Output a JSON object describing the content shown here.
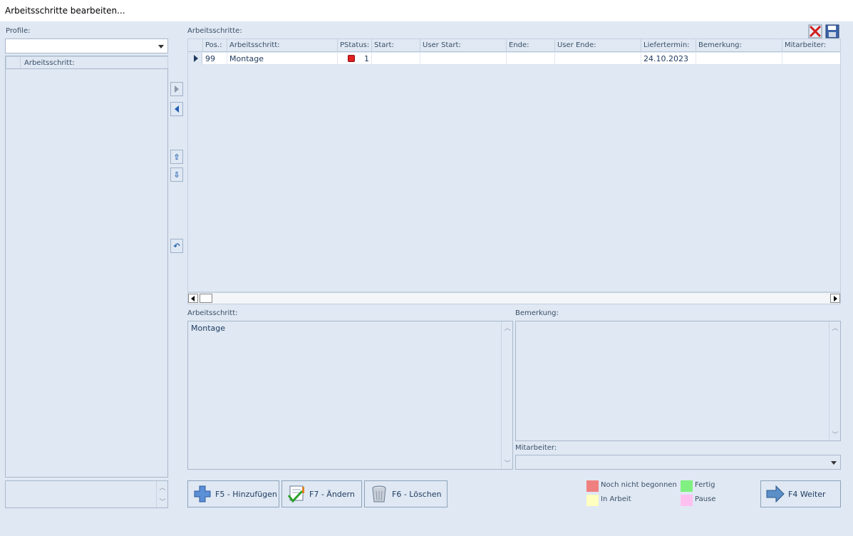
{
  "window": {
    "title": "Arbeitsschritte bearbeiten..."
  },
  "left": {
    "profile_label": "Profile:",
    "profile_value": "",
    "grid_header": "Arbeitsschritt:"
  },
  "main": {
    "section_label": "Arbeitsschritte:",
    "columns": [
      "Pos.:",
      "Arbeitsschritt:",
      "PStatus:",
      "Start:",
      "User Start:",
      "Ende:",
      "User Ende:",
      "Liefertermin:",
      "Bemerkung:",
      "Mitarbeiter:"
    ],
    "rows": [
      {
        "pos": "99",
        "arbeitsschritt": "Montage",
        "pstatus": "1",
        "pstatus_color": "#e02020",
        "start": "",
        "user_start": "",
        "ende": "",
        "user_ende": "",
        "liefertermin": "24.10.2023",
        "bemerkung": "",
        "mitarbeiter": ""
      }
    ]
  },
  "details": {
    "arbeitsschritt_label": "Arbeitsschritt:",
    "arbeitsschritt_value": "Montage",
    "bemerkung_label": "Bemerkung:",
    "bemerkung_value": "",
    "mitarbeiter_label": "Mitarbeiter:",
    "mitarbeiter_value": ""
  },
  "buttons": {
    "add": {
      "label": "F5 - Hinzufügen",
      "icon": "plus-icon"
    },
    "edit": {
      "label": "F7 - Ändern",
      "icon": "edit-check-icon"
    },
    "delete": {
      "label": "F6 - Löschen",
      "icon": "trash-icon"
    },
    "next": {
      "label": "F4 Weiter",
      "icon": "arrow-right-icon"
    }
  },
  "legend": [
    {
      "label": "Noch nicht begonnen",
      "color": "#f08080"
    },
    {
      "label": "Fertig",
      "color": "#80f080"
    },
    {
      "label": "In Arbeit",
      "color": "#ffffc0"
    },
    {
      "label": "Pause",
      "color": "#ffc0f0"
    }
  ]
}
